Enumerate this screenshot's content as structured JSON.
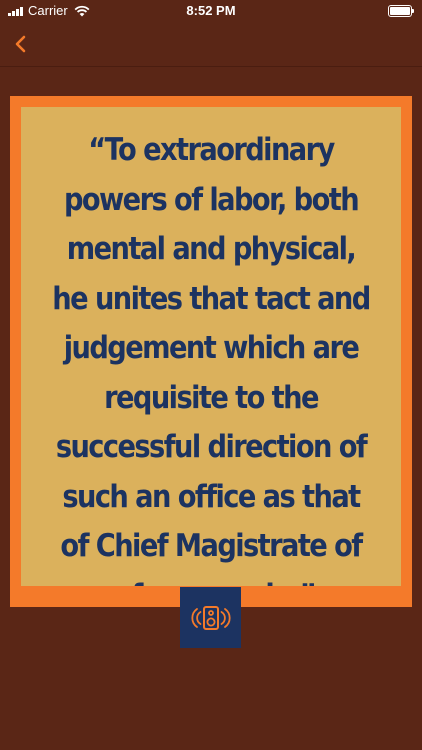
{
  "status_bar": {
    "carrier": "Carrier",
    "time": "8:52 PM"
  },
  "nav": {
    "back_icon": "chevron-left-icon"
  },
  "quote": {
    "text": "“To extraordinary powers of labor, both mental and physical, he unites that tact and judgement which are requisite to the successful direction of such an office as that of Chief Magistrate of a free people.”"
  },
  "audio": {
    "icon": "speaker-icon"
  },
  "colors": {
    "background": "#5a2616",
    "frame": "#f47a2a",
    "card": "#dbb15c",
    "text": "#1c3361",
    "accent": "#f47a2a"
  }
}
